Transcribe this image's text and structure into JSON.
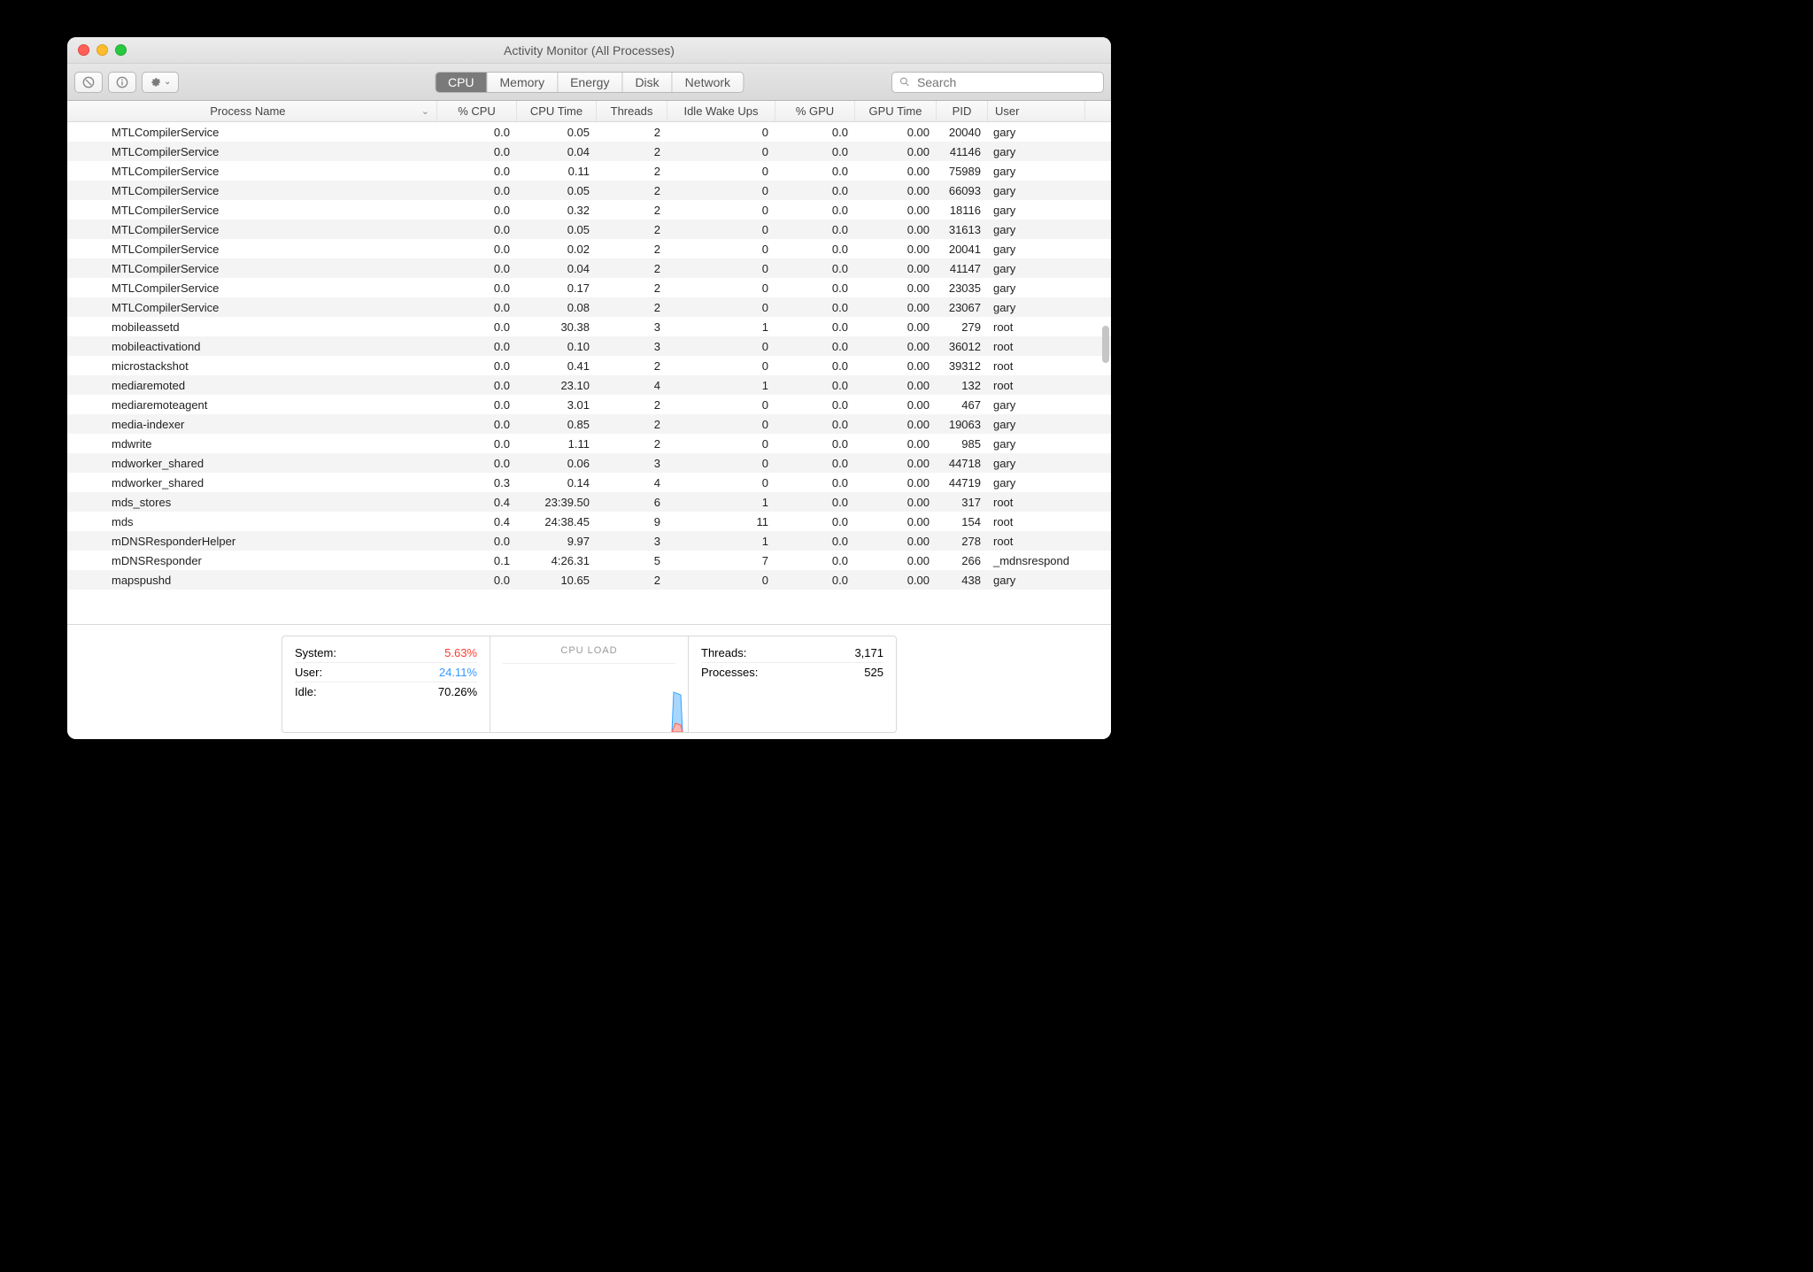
{
  "window": {
    "title": "Activity Monitor (All Processes)"
  },
  "toolbar": {
    "tabs": [
      "CPU",
      "Memory",
      "Energy",
      "Disk",
      "Network"
    ],
    "active_tab_index": 0,
    "search_placeholder": "Search"
  },
  "columns": {
    "name": "Process Name",
    "cpu": "% CPU",
    "time": "CPU Time",
    "threads": "Threads",
    "wake": "Idle Wake Ups",
    "gpu": "% GPU",
    "gputime": "GPU Time",
    "pid": "PID",
    "user": "User",
    "sorted_column": "name",
    "sort_dir": "desc"
  },
  "summary": {
    "system_label": "System:",
    "system_value": "5.63%",
    "user_label": "User:",
    "user_value": "24.11%",
    "idle_label": "Idle:",
    "idle_value": "70.26%",
    "cpu_load_label": "CPU LOAD",
    "threads_label": "Threads:",
    "threads_value": "3,171",
    "processes_label": "Processes:",
    "processes_value": "525"
  },
  "rows": [
    {
      "name": "MTLCompilerService",
      "cpu": "0.0",
      "time": "0.05",
      "threads": "2",
      "wake": "0",
      "gpu": "0.0",
      "gputime": "0.00",
      "pid": "20040",
      "user": "gary"
    },
    {
      "name": "MTLCompilerService",
      "cpu": "0.0",
      "time": "0.04",
      "threads": "2",
      "wake": "0",
      "gpu": "0.0",
      "gputime": "0.00",
      "pid": "41146",
      "user": "gary"
    },
    {
      "name": "MTLCompilerService",
      "cpu": "0.0",
      "time": "0.11",
      "threads": "2",
      "wake": "0",
      "gpu": "0.0",
      "gputime": "0.00",
      "pid": "75989",
      "user": "gary"
    },
    {
      "name": "MTLCompilerService",
      "cpu": "0.0",
      "time": "0.05",
      "threads": "2",
      "wake": "0",
      "gpu": "0.0",
      "gputime": "0.00",
      "pid": "66093",
      "user": "gary"
    },
    {
      "name": "MTLCompilerService",
      "cpu": "0.0",
      "time": "0.32",
      "threads": "2",
      "wake": "0",
      "gpu": "0.0",
      "gputime": "0.00",
      "pid": "18116",
      "user": "gary"
    },
    {
      "name": "MTLCompilerService",
      "cpu": "0.0",
      "time": "0.05",
      "threads": "2",
      "wake": "0",
      "gpu": "0.0",
      "gputime": "0.00",
      "pid": "31613",
      "user": "gary"
    },
    {
      "name": "MTLCompilerService",
      "cpu": "0.0",
      "time": "0.02",
      "threads": "2",
      "wake": "0",
      "gpu": "0.0",
      "gputime": "0.00",
      "pid": "20041",
      "user": "gary"
    },
    {
      "name": "MTLCompilerService",
      "cpu": "0.0",
      "time": "0.04",
      "threads": "2",
      "wake": "0",
      "gpu": "0.0",
      "gputime": "0.00",
      "pid": "41147",
      "user": "gary"
    },
    {
      "name": "MTLCompilerService",
      "cpu": "0.0",
      "time": "0.17",
      "threads": "2",
      "wake": "0",
      "gpu": "0.0",
      "gputime": "0.00",
      "pid": "23035",
      "user": "gary"
    },
    {
      "name": "MTLCompilerService",
      "cpu": "0.0",
      "time": "0.08",
      "threads": "2",
      "wake": "0",
      "gpu": "0.0",
      "gputime": "0.00",
      "pid": "23067",
      "user": "gary"
    },
    {
      "name": "mobileassetd",
      "cpu": "0.0",
      "time": "30.38",
      "threads": "3",
      "wake": "1",
      "gpu": "0.0",
      "gputime": "0.00",
      "pid": "279",
      "user": "root"
    },
    {
      "name": "mobileactivationd",
      "cpu": "0.0",
      "time": "0.10",
      "threads": "3",
      "wake": "0",
      "gpu": "0.0",
      "gputime": "0.00",
      "pid": "36012",
      "user": "root"
    },
    {
      "name": "microstackshot",
      "cpu": "0.0",
      "time": "0.41",
      "threads": "2",
      "wake": "0",
      "gpu": "0.0",
      "gputime": "0.00",
      "pid": "39312",
      "user": "root"
    },
    {
      "name": "mediaremoted",
      "cpu": "0.0",
      "time": "23.10",
      "threads": "4",
      "wake": "1",
      "gpu": "0.0",
      "gputime": "0.00",
      "pid": "132",
      "user": "root"
    },
    {
      "name": "mediaremoteagent",
      "cpu": "0.0",
      "time": "3.01",
      "threads": "2",
      "wake": "0",
      "gpu": "0.0",
      "gputime": "0.00",
      "pid": "467",
      "user": "gary"
    },
    {
      "name": "media-indexer",
      "cpu": "0.0",
      "time": "0.85",
      "threads": "2",
      "wake": "0",
      "gpu": "0.0",
      "gputime": "0.00",
      "pid": "19063",
      "user": "gary"
    },
    {
      "name": "mdwrite",
      "cpu": "0.0",
      "time": "1.11",
      "threads": "2",
      "wake": "0",
      "gpu": "0.0",
      "gputime": "0.00",
      "pid": "985",
      "user": "gary"
    },
    {
      "name": "mdworker_shared",
      "cpu": "0.0",
      "time": "0.06",
      "threads": "3",
      "wake": "0",
      "gpu": "0.0",
      "gputime": "0.00",
      "pid": "44718",
      "user": "gary"
    },
    {
      "name": "mdworker_shared",
      "cpu": "0.3",
      "time": "0.14",
      "threads": "4",
      "wake": "0",
      "gpu": "0.0",
      "gputime": "0.00",
      "pid": "44719",
      "user": "gary"
    },
    {
      "name": "mds_stores",
      "cpu": "0.4",
      "time": "23:39.50",
      "threads": "6",
      "wake": "1",
      "gpu": "0.0",
      "gputime": "0.00",
      "pid": "317",
      "user": "root"
    },
    {
      "name": "mds",
      "cpu": "0.4",
      "time": "24:38.45",
      "threads": "9",
      "wake": "11",
      "gpu": "0.0",
      "gputime": "0.00",
      "pid": "154",
      "user": "root"
    },
    {
      "name": "mDNSResponderHelper",
      "cpu": "0.0",
      "time": "9.97",
      "threads": "3",
      "wake": "1",
      "gpu": "0.0",
      "gputime": "0.00",
      "pid": "278",
      "user": "root"
    },
    {
      "name": "mDNSResponder",
      "cpu": "0.1",
      "time": "4:26.31",
      "threads": "5",
      "wake": "7",
      "gpu": "0.0",
      "gputime": "0.00",
      "pid": "266",
      "user": "_mdnsrespond"
    },
    {
      "name": "mapspushd",
      "cpu": "0.0",
      "time": "10.65",
      "threads": "2",
      "wake": "0",
      "gpu": "0.0",
      "gputime": "0.00",
      "pid": "438",
      "user": "gary"
    }
  ]
}
